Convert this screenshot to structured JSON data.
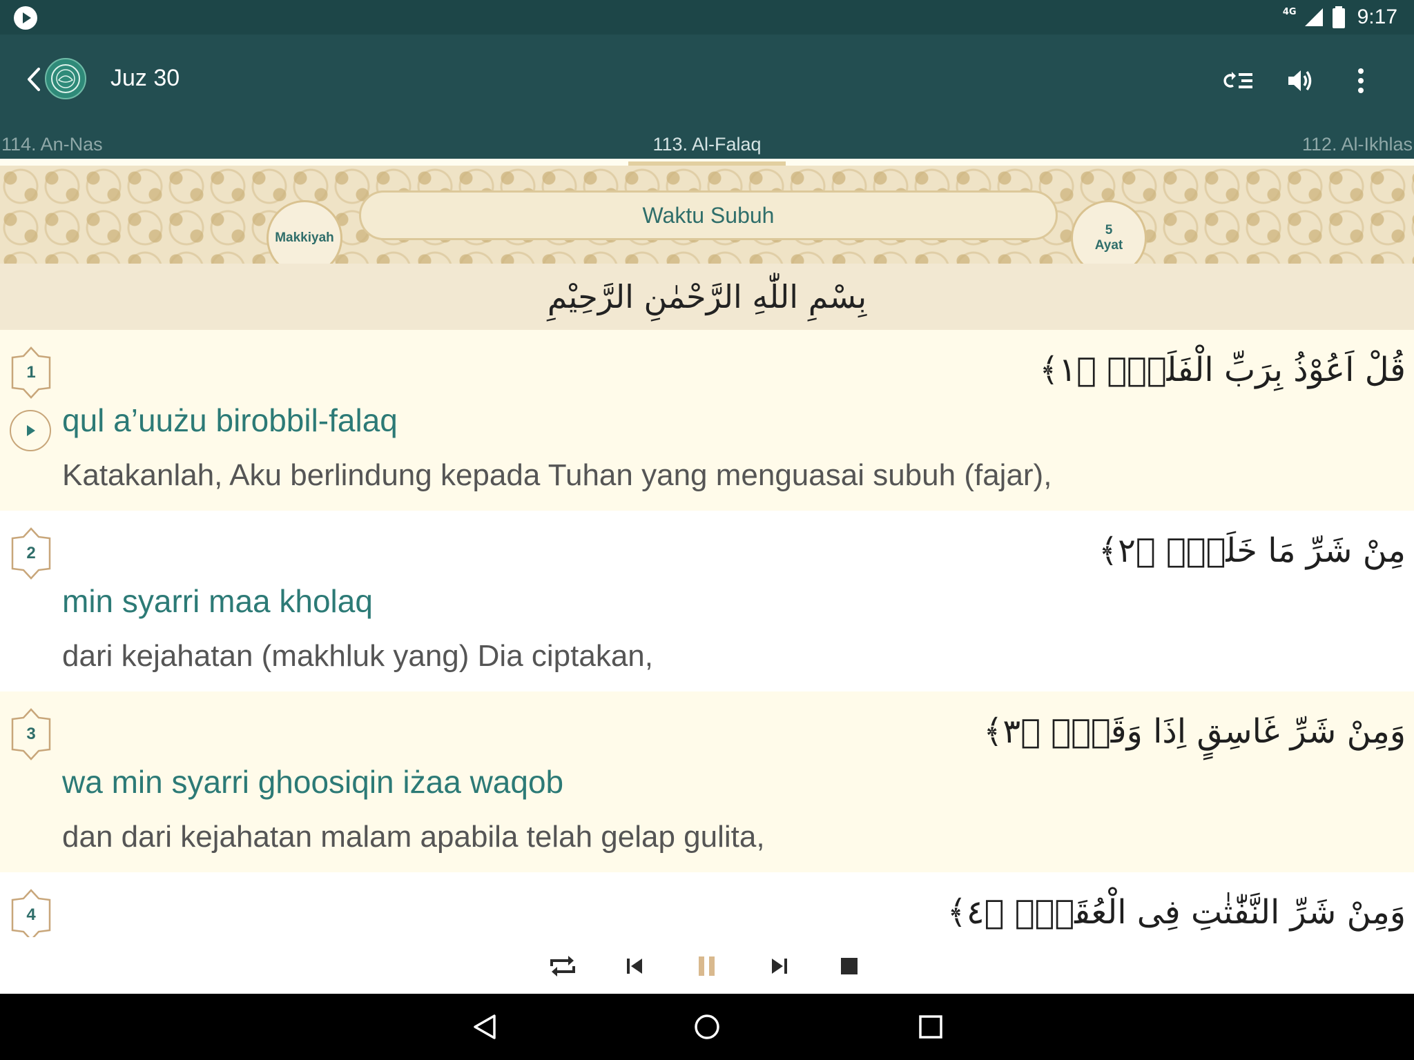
{
  "status_bar": {
    "network": "4G",
    "time": "9:17"
  },
  "app_bar": {
    "title": "Juz 30"
  },
  "tabs": {
    "prev": "114. An-Nas",
    "active": "113. Al-Falaq",
    "next": "112. Al-Ikhlas"
  },
  "surah_header": {
    "revelation": "Makkiyah",
    "name_meaning": "Waktu Subuh",
    "ayat_count": "5",
    "ayat_label": "Ayat"
  },
  "bismillah": "بِسْمِ اللّٰهِ الرَّحْمٰنِ الرَّحِيْمِ",
  "verses": [
    {
      "number": "1",
      "arabic": "قُلْ اَعُوْذُ بِرَبِّ الْفَلَقِۙ ﴿١﴾",
      "transliteration": "qul a’uużu birobbil-falaq",
      "translation": "Katakanlah, Aku berlindung kepada Tuhan yang menguasai subuh (fajar),"
    },
    {
      "number": "2",
      "arabic": "مِنْ شَرِّ مَا خَلَقَۙ ﴿٢﴾",
      "transliteration": "min syarri maa kholaq",
      "translation": "dari kejahatan (makhluk yang) Dia ciptakan,"
    },
    {
      "number": "3",
      "arabic": "وَمِنْ شَرِّ غَاسِقٍ اِذَا وَقَبَۙ ﴿٣﴾",
      "transliteration": "wa min syarri ghoosiqin iżaa waqob",
      "translation": "dan dari kejahatan malam apabila telah gelap gulita,"
    },
    {
      "number": "4",
      "arabic": "وَمِنْ شَرِّ النَّفّٰثٰتِ فِى الْعُقَدِۙ ﴿٤﴾",
      "transliteration": "",
      "translation": ""
    }
  ],
  "colors": {
    "primary": "#234e51",
    "status_bar": "#1d4648",
    "accent_teal": "#2c7a76",
    "gold": "#c8a67a"
  }
}
